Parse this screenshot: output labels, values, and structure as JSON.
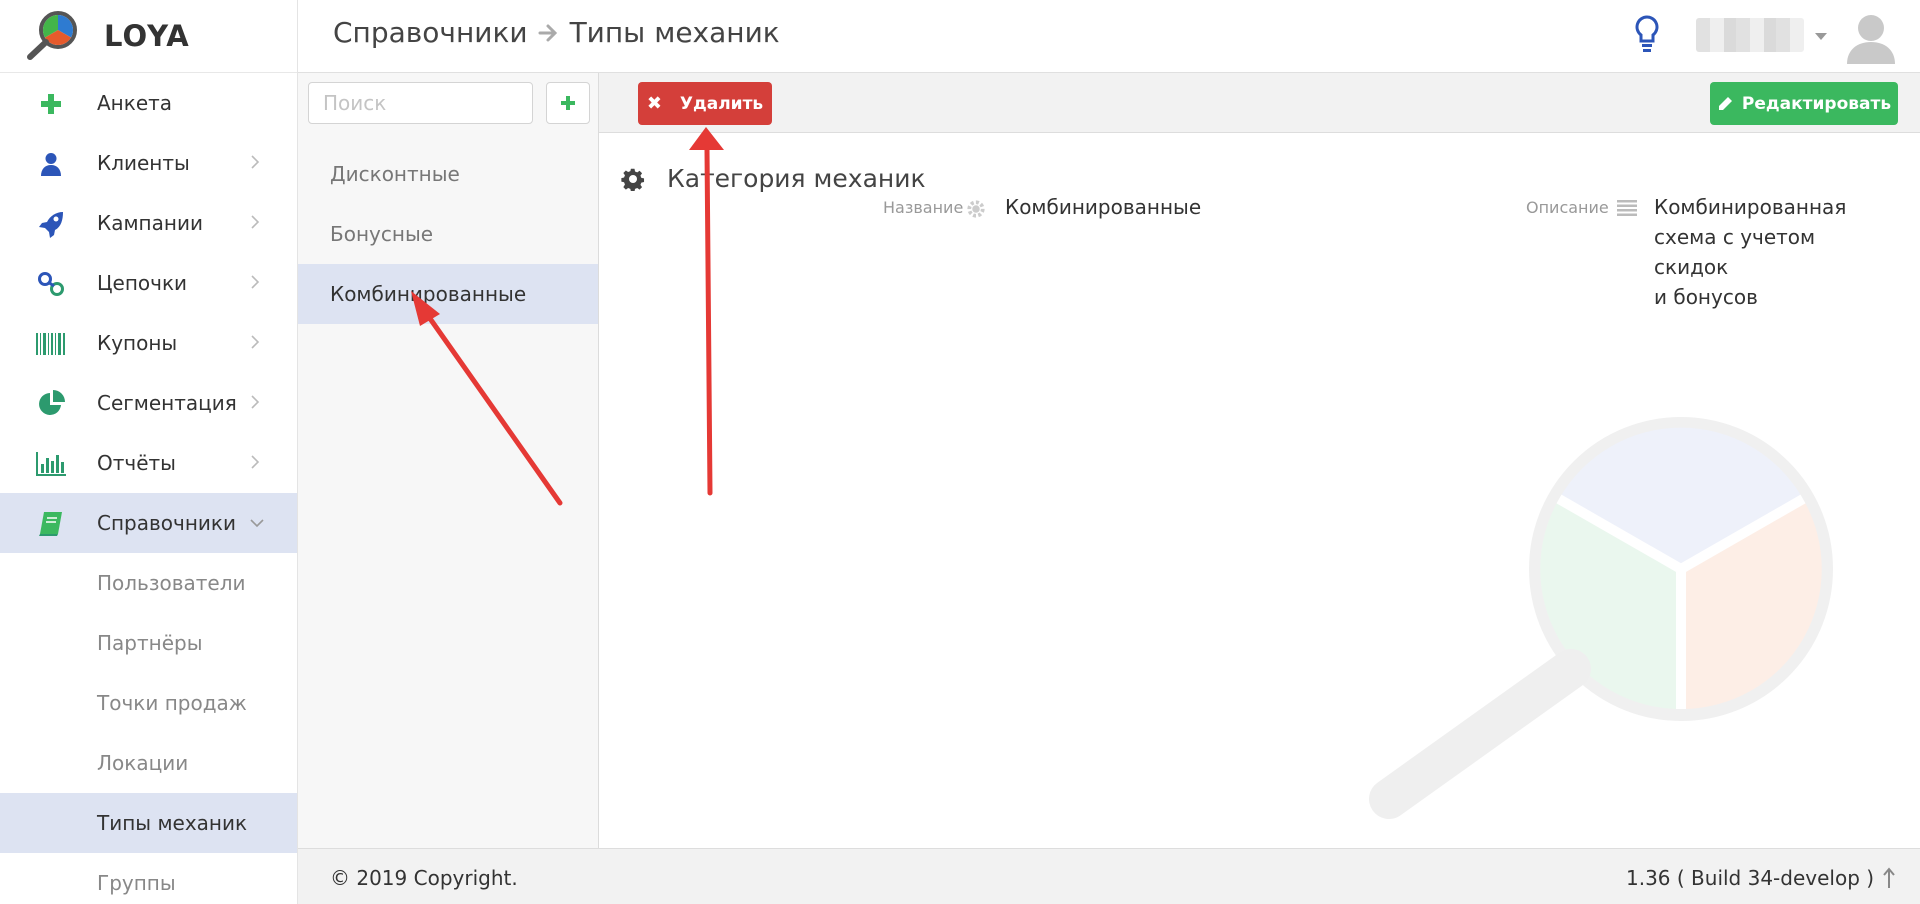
{
  "app": {
    "name": "LOYA"
  },
  "sidebar": {
    "items": [
      {
        "label": "Анкета",
        "icon": "plus-icon"
      },
      {
        "label": "Клиенты",
        "icon": "user-icon"
      },
      {
        "label": "Кампании",
        "icon": "rocket-icon"
      },
      {
        "label": "Цепочки",
        "icon": "link-icon"
      },
      {
        "label": "Купоны",
        "icon": "barcode-icon"
      },
      {
        "label": "Сегментация",
        "icon": "pie-chart-icon"
      },
      {
        "label": "Отчёты",
        "icon": "bar-chart-icon"
      },
      {
        "label": "Справочники",
        "icon": "book-icon"
      }
    ],
    "subitems": [
      "Пользователи",
      "Партнёры",
      "Точки продаж",
      "Локации",
      "Типы механик",
      "Группы"
    ]
  },
  "header": {
    "breadcrumb_parent": "Справочники",
    "breadcrumb_current": "Типы механик"
  },
  "list_panel": {
    "search_placeholder": "Поиск",
    "items": [
      "Дисконтные",
      "Бонусные",
      "Комбинированные"
    ]
  },
  "toolbar": {
    "delete_label": "Удалить",
    "edit_label": "Редактировать"
  },
  "detail": {
    "section_title": "Категория механик",
    "name_label": "Название",
    "name_value": "Комбинированные",
    "description_label": "Описание",
    "description_line1": "Комбинированная",
    "description_line2": "схема с учетом скидок",
    "description_line3": "и бонусов"
  },
  "footer": {
    "copyright": "© 2019 Copyright.",
    "version": "1.36 ( Build 34-develop )"
  },
  "colors": {
    "delete": "#d43f3a",
    "edit": "#3bb85f",
    "active_bg": "#dde3f2",
    "annotation": "#e53935"
  }
}
